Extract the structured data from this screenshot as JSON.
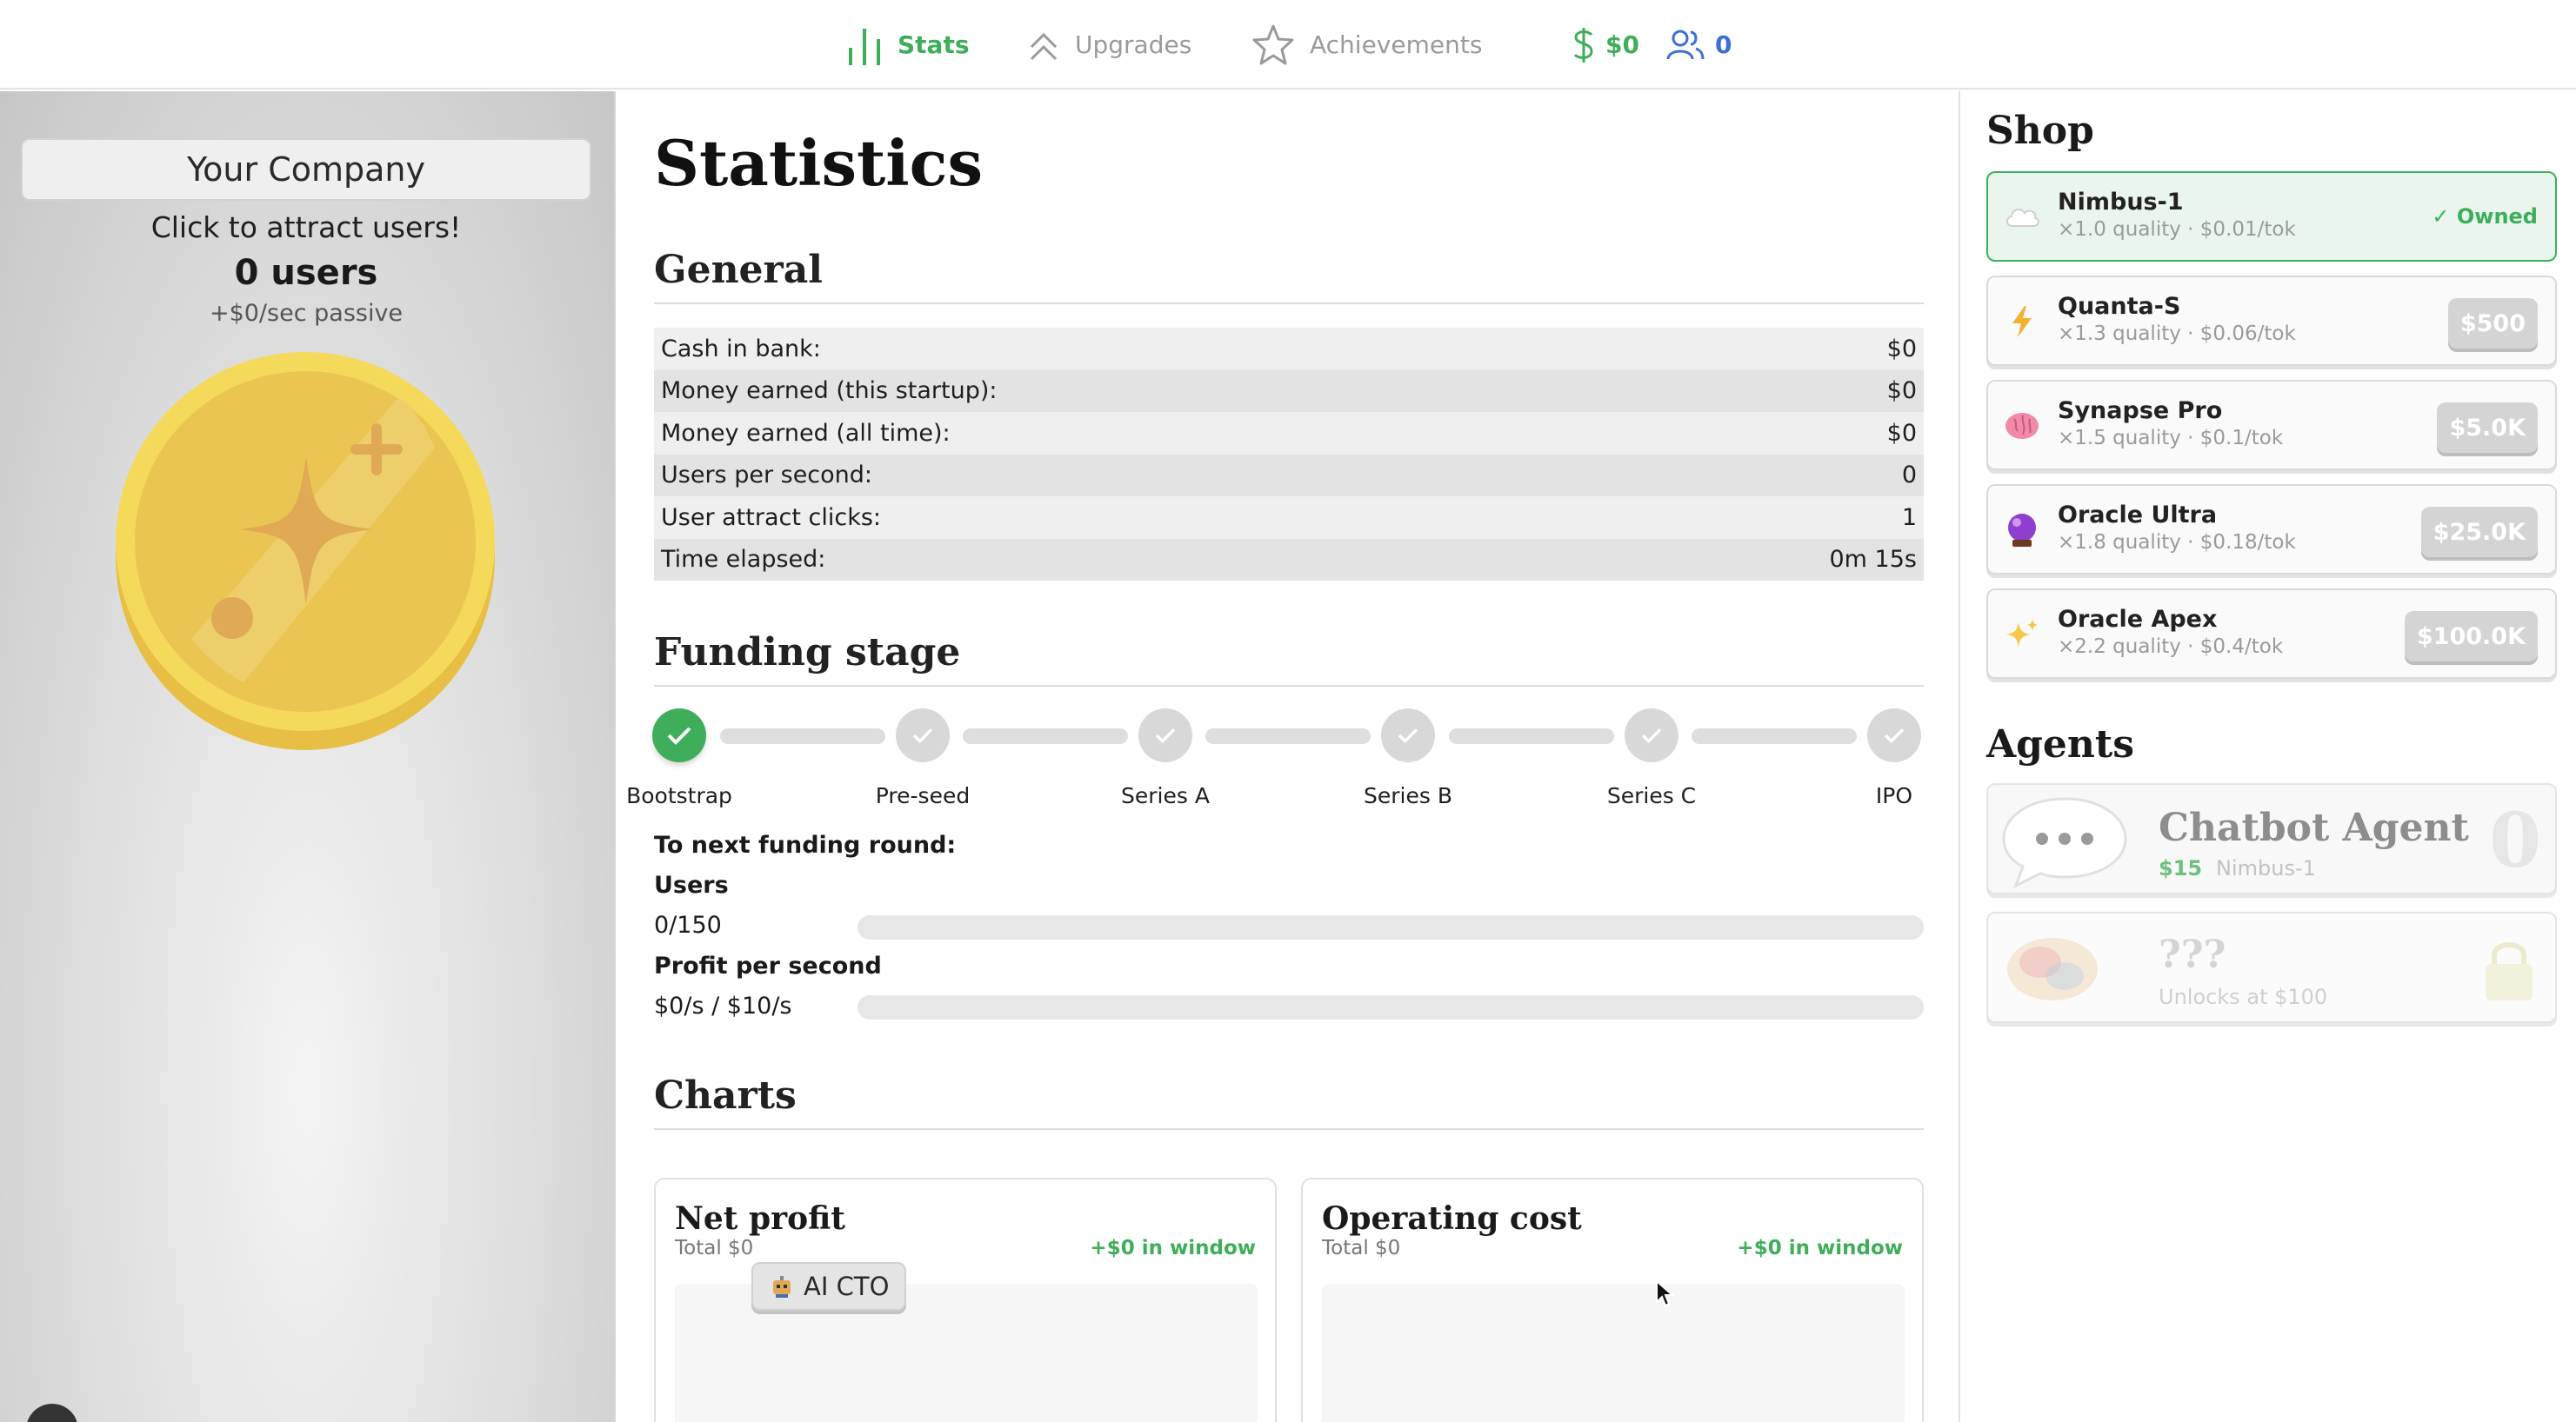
{
  "nav": {
    "tabs": [
      {
        "label": "Stats",
        "icon": "bar-chart-icon",
        "active": true
      },
      {
        "label": "Upgrades",
        "icon": "double-chevron-up-icon",
        "active": false
      },
      {
        "label": "Achievements",
        "icon": "star-icon",
        "active": false
      }
    ],
    "money": "$0",
    "users": "0"
  },
  "left": {
    "company_name": "Your Company",
    "attract_text": "Click to attract users!",
    "users_count": "0 users",
    "passive": "+$0/sec passive",
    "coin_icon": "sparkle-coin-icon"
  },
  "main": {
    "title": "Statistics",
    "general": {
      "heading": "General",
      "rows": [
        {
          "label": "Cash in bank:",
          "value": "$0"
        },
        {
          "label": "Money earned (this startup):",
          "value": "$0"
        },
        {
          "label": "Money earned (all time):",
          "value": "$0"
        },
        {
          "label": "Users per second:",
          "value": "0"
        },
        {
          "label": "User attract clicks:",
          "value": "1"
        },
        {
          "label": "Time elapsed:",
          "value": "0m 15s"
        }
      ]
    },
    "funding": {
      "heading": "Funding stage",
      "stages": [
        {
          "label": "Bootstrap",
          "done": true
        },
        {
          "label": "Pre-seed",
          "done": false
        },
        {
          "label": "Series A",
          "done": false
        },
        {
          "label": "Series B",
          "done": false
        },
        {
          "label": "Series C",
          "done": false
        },
        {
          "label": "IPO",
          "done": false
        }
      ],
      "next_round_label": "To next funding round:",
      "users_label": "Users",
      "users_progress_text": "0/150",
      "users_progress": 0,
      "profit_label": "Profit per second",
      "profit_progress_text": "$0/s / $10/s",
      "profit_progress": 0
    },
    "charts": {
      "heading": "Charts",
      "cards": [
        {
          "title": "Net profit",
          "total": "Total $0",
          "window": "+$0 in window"
        },
        {
          "title": "Operating cost",
          "total": "Total $0",
          "window": "+$0 in window"
        }
      ]
    },
    "cto_badge": {
      "label": "AI CTO",
      "icon": "robot-icon"
    }
  },
  "shop": {
    "heading": "Shop",
    "items": [
      {
        "name": "Nimbus-1",
        "sub": "×1.0 quality · $0.01/tok",
        "icon": "cloud-icon",
        "status": "✓ Owned",
        "owned": true
      },
      {
        "name": "Quanta-S",
        "sub": "×1.3 quality · $0.06/tok",
        "icon": "lightning-icon",
        "price": "$500",
        "owned": false
      },
      {
        "name": "Synapse Pro",
        "sub": "×1.5 quality · $0.1/tok",
        "icon": "brain-icon",
        "price": "$5.0K",
        "owned": false
      },
      {
        "name": "Oracle Ultra",
        "sub": "×1.8 quality · $0.18/tok",
        "icon": "crystal-ball-icon",
        "price": "$25.0K",
        "owned": false
      },
      {
        "name": "Oracle Apex",
        "sub": "×2.2 quality · $0.4/tok",
        "icon": "sparkles-icon",
        "price": "$100.0K",
        "owned": false
      }
    ]
  },
  "agents": {
    "heading": "Agents",
    "items": [
      {
        "name": "Chatbot Agent",
        "price": "$15",
        "model": "Nimbus-1",
        "count": "0",
        "icon": "speech-bubble-icon"
      },
      {
        "name": "???",
        "unlock": "Unlocks at $100",
        "icon": "lock-icon"
      }
    ]
  },
  "colors": {
    "accent_green": "#3fae5a",
    "accent_blue": "#3a6fd8",
    "coin_gold": "#f2d25e"
  }
}
